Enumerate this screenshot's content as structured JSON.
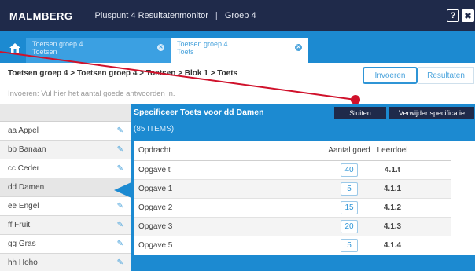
{
  "header": {
    "logo": "MALMBERG",
    "app_title": "Pluspunt 4 Resultatenmonitor",
    "separator": "|",
    "group": "Groep 4",
    "help_label": "?",
    "close_label": "✖"
  },
  "tabs": [
    {
      "title": "Toetsen groep 4",
      "subtitle": "Toetsen"
    },
    {
      "title": "Toetsen groep 4",
      "subtitle": "Toets"
    }
  ],
  "breadcrumb": "Toetsen groep 4 > Toetsen groep 4 > Toetsen > Blok 1 > Toets",
  "view_buttons": {
    "invoeren": "Invoeren",
    "resultaten": "Resultaten"
  },
  "hint": "Invoeren: Vul hier het aantal goede antwoorden in.",
  "students": [
    "aa Appel",
    "bb Banaan",
    "cc Ceder",
    "dd Damen",
    "ee Engel",
    "ff Fruit",
    "gg Gras",
    "hh Hoho"
  ],
  "spec": {
    "title": "Specificeer Toets voor dd Damen",
    "count": "(85 ITEMS)",
    "close_label": "Sluiten",
    "remove_label": "Verwijder specificatie"
  },
  "table": {
    "headers": {
      "opdracht": "Opdracht",
      "aantal": "Aantal goed",
      "leerdoel": "Leerdoel"
    },
    "rows": [
      {
        "opdracht": "Opgave t",
        "aantal": "40",
        "leerdoel": "4.1.t"
      },
      {
        "opdracht": "Opgave 1",
        "aantal": "5",
        "leerdoel": "4.1.1"
      },
      {
        "opdracht": "Opgave 2",
        "aantal": "15",
        "leerdoel": "4.1.2"
      },
      {
        "opdracht": "Opgave 3",
        "aantal": "20",
        "leerdoel": "4.1.3"
      },
      {
        "opdracht": "Opgave 5",
        "aantal": "5",
        "leerdoel": "4.1.4"
      }
    ]
  },
  "colors": {
    "navy": "#1f2a4a",
    "blue": "#1c8ad1",
    "annotation": "#d0112b"
  },
  "icons": {
    "home": "home-icon",
    "edit": "edit-icon",
    "close_tab": "close-tab-icon"
  }
}
